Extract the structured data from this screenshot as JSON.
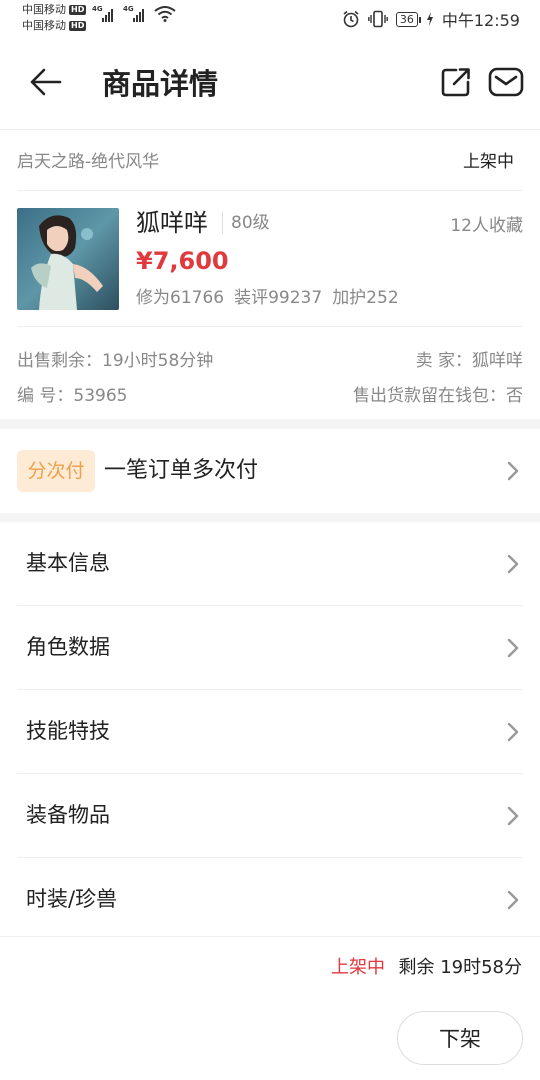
{
  "status_bar": {
    "carrier_1": "中国移动",
    "carrier_2": "中国移动",
    "hd_badge": "HD",
    "network_1": "4G",
    "network_2": "4G",
    "battery": "36",
    "time": "中午12:59"
  },
  "nav": {
    "title": "商品详情",
    "back_icon": "arrow-left-icon",
    "share_icon": "external-link-icon",
    "message_icon": "mail-icon"
  },
  "product": {
    "game_server": "启天之路-绝代风华",
    "listing_status": "上架中",
    "character_name": "狐咩咩",
    "level": "80级",
    "favorites": "12人收藏",
    "price": "¥7,600",
    "cultivation": "修为61766",
    "equip_score": "装评99237",
    "protection": "加护252",
    "time_left": "出售剩余：19小时58分钟",
    "seller": "卖 家：狐咩咩",
    "serial": "编 号：53965",
    "wallet_note": "售出货款留在钱包：否"
  },
  "installment": {
    "tag": "分次付",
    "text": "一笔订单多次付"
  },
  "menu": {
    "items": [
      {
        "label": "基本信息"
      },
      {
        "label": "角色数据"
      },
      {
        "label": "技能特技"
      },
      {
        "label": "装备物品"
      },
      {
        "label": "时装/珍兽"
      }
    ]
  },
  "bottom": {
    "status": "上架中",
    "remaining": "剩余 19时58分",
    "delist_button": "下架"
  },
  "colors": {
    "price_red": "#e0393e",
    "tag_bg": "#fdebd6",
    "tag_text": "#f0a04a",
    "divider": "#eeeeee"
  }
}
